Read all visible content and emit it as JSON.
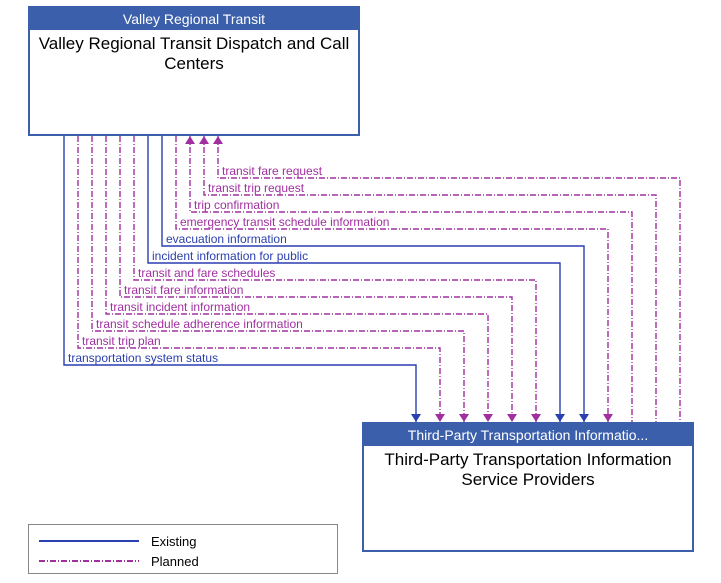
{
  "nodes": {
    "top": {
      "header": "Valley Regional Transit",
      "body": "Valley Regional Transit Dispatch and Call Centers"
    },
    "bottom": {
      "header": "Third-Party Transportation Informatio...",
      "body": "Third-Party Transportation Information Service Providers"
    }
  },
  "flows": [
    {
      "label": "transit fare request",
      "style": "planned",
      "dir": "to_top"
    },
    {
      "label": "transit trip request",
      "style": "planned",
      "dir": "to_top"
    },
    {
      "label": "trip confirmation",
      "style": "planned",
      "dir": "to_top"
    },
    {
      "label": "emergency transit schedule information",
      "style": "planned",
      "dir": "to_bottom"
    },
    {
      "label": "evacuation information",
      "style": "existing",
      "dir": "to_bottom"
    },
    {
      "label": "incident information for public",
      "style": "existing",
      "dir": "to_bottom"
    },
    {
      "label": "transit and fare schedules",
      "style": "planned",
      "dir": "to_bottom"
    },
    {
      "label": "transit fare information",
      "style": "planned",
      "dir": "to_bottom"
    },
    {
      "label": "transit incident information",
      "style": "planned",
      "dir": "to_bottom"
    },
    {
      "label": "transit schedule adherence information",
      "style": "planned",
      "dir": "to_bottom"
    },
    {
      "label": "transit trip plan",
      "style": "planned",
      "dir": "to_bottom"
    },
    {
      "label": "transportation system status",
      "style": "existing",
      "dir": "to_bottom"
    }
  ],
  "legend": {
    "existing": "Existing",
    "planned": "Planned"
  },
  "colors": {
    "existing": "#2a3fb0",
    "planned": "#a030a0",
    "node_border": "#3b5faa"
  }
}
